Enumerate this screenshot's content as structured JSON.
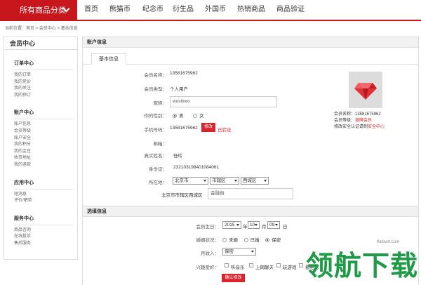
{
  "nav": {
    "category_button": "所有商品分类",
    "items": [
      "首页",
      "熊猫币",
      "纪念币",
      "衍生品",
      "外国币",
      "热销商品",
      "商品验证"
    ]
  },
  "breadcrumb": "当前位置：首页 > 会员中心 > 基本信息",
  "sidebar": {
    "title": "会员中心",
    "groups": [
      {
        "title": "订单中心",
        "links": [
          "我的订单",
          "我的竞价",
          "我的关注",
          "我的预订"
        ]
      },
      {
        "title": "账户中心",
        "links": [
          "账户信息",
          "会员等级",
          "账户安全",
          "我的积分",
          "我的金豆",
          "收货地址",
          "我的退款"
        ]
      },
      {
        "title": "应用中心",
        "links": [
          "短消息",
          "评价/晒单"
        ]
      },
      {
        "title": "服务中心",
        "links": [
          "商品咨询",
          "在线投诉",
          "售后服务"
        ]
      }
    ]
  },
  "account": {
    "section_title": "账户信息",
    "tab_label": "基本信息",
    "fields": {
      "member_name_label": "会员名称：",
      "member_name": "13581675962",
      "member_type_label": "会员类型：",
      "member_type": "个人用户",
      "nickname_label": "昵称：",
      "nickname": "woshiwo",
      "gender_label": "你的性别：",
      "gender_male": "男",
      "gender_female": "女",
      "phone_label": "手机号码：",
      "phone": "13581675962",
      "phone_edit": "修改",
      "phone_verified": "已验证",
      "email_label": "邮箱：",
      "realname_label": "真实姓名：",
      "realname": "任玲",
      "idcard_label": "身份证：",
      "idcard": "232103198401084061",
      "location_label": "所在地：",
      "province": "北京市",
      "city": "市辖区",
      "district": "西城区",
      "address_prefix": "北京市市辖区西城区",
      "address_detail": "金融街"
    },
    "profile_card": {
      "member_name": "会员名称：13581675962",
      "level_prefix": "会员等级：",
      "level": "银牌会员",
      "security_prefix": "修改安全认证请到",
      "security_link": "安全中心"
    }
  },
  "optional": {
    "section_title": "选填信息",
    "birthday_label": "会员生日：",
    "year": "2015",
    "year_unit": "年",
    "month": "10",
    "month_unit": "月",
    "day": "09",
    "day_unit": "日",
    "marital_label": "婚姻状况：",
    "marital_options": [
      "未婚",
      "已婚",
      "保密"
    ],
    "income_label": "月收入：",
    "income": "保密",
    "interests_label": "兴趣爱好：",
    "interests": [
      "听音乐",
      "上网聊天",
      "玩游戏",
      "看电影"
    ],
    "confirm_button": "确认修改"
  },
  "watermark": {
    "text": "领航下载",
    "url": "lhdown.com"
  },
  "colors": {
    "accent": "#c8161d",
    "button": "#d9232d",
    "watermark": "#1f9a46"
  }
}
